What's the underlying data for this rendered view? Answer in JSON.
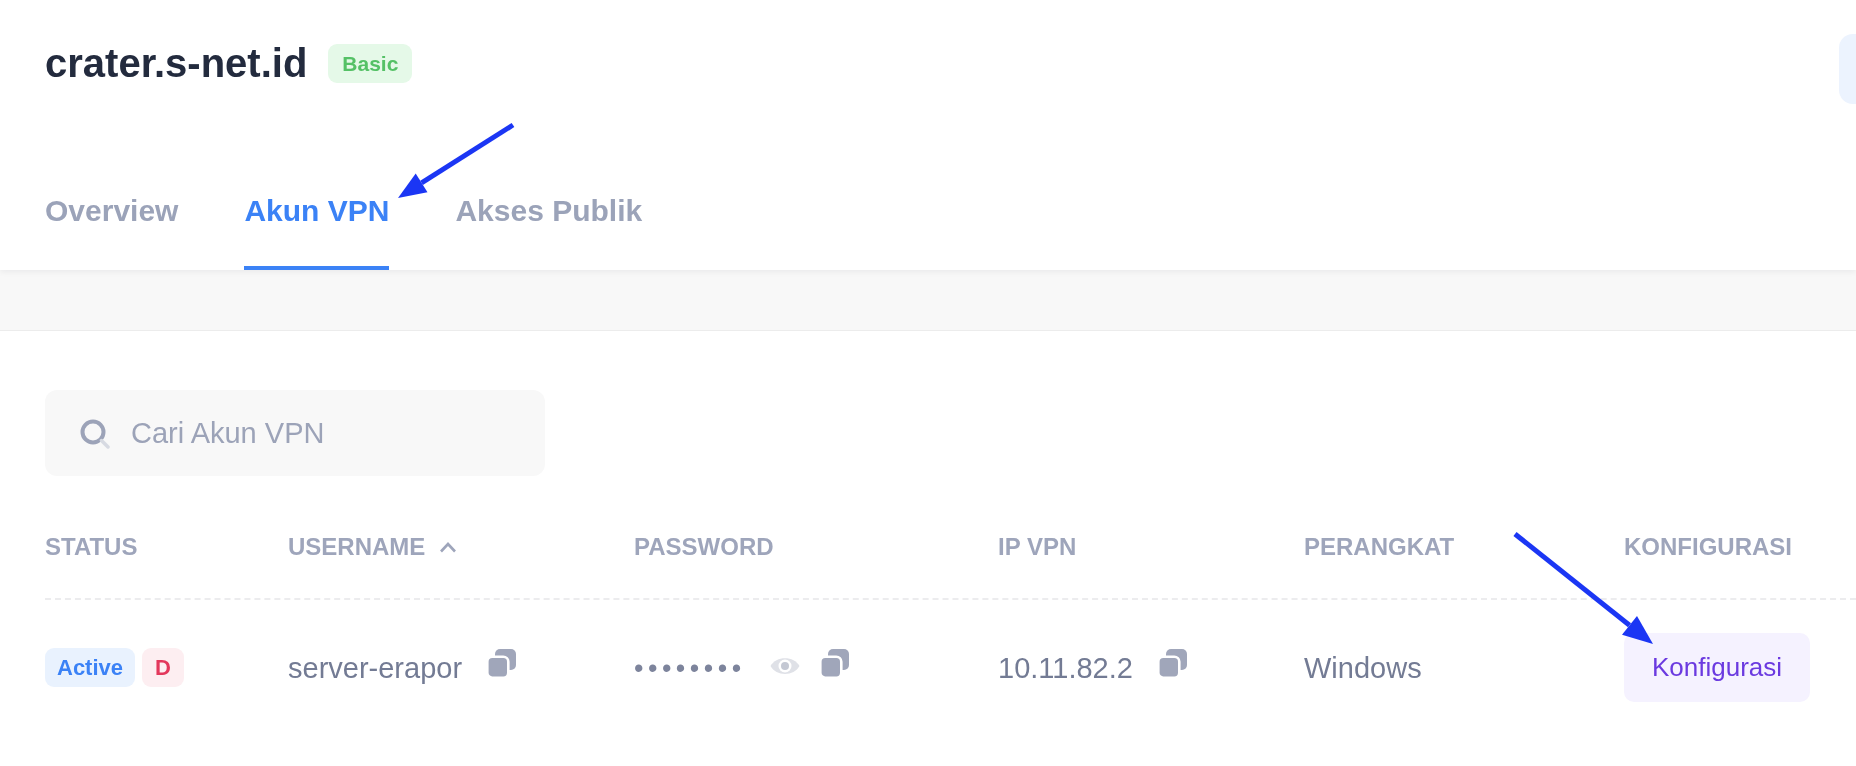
{
  "header": {
    "title": "crater.s-net.id",
    "plan_badge": "Basic"
  },
  "tabs": [
    {
      "label": "Overview",
      "selected": false
    },
    {
      "label": "Akun VPN",
      "selected": true
    },
    {
      "label": "Akses Publik",
      "selected": false
    }
  ],
  "search": {
    "placeholder": "Cari Akun VPN"
  },
  "table": {
    "columns": [
      {
        "label": "STATUS",
        "sorted": false
      },
      {
        "label": "USERNAME",
        "sorted": true
      },
      {
        "label": "PASSWORD",
        "sorted": false
      },
      {
        "label": "IP VPN",
        "sorted": false
      },
      {
        "label": "PERANGKAT",
        "sorted": false
      },
      {
        "label": "KONFIGURASI",
        "sorted": false
      }
    ],
    "rows": [
      {
        "badges": [
          {
            "text": "Active",
            "kind": "status"
          },
          {
            "text": "D",
            "kind": "flag"
          }
        ],
        "username": "server-erapor",
        "password": "••••••••",
        "ip_vpn": "10.11.82.2",
        "device": "Windows",
        "config_button": "Konfigurasi"
      }
    ]
  },
  "annotations": {
    "arrow_to_selected_tab": true,
    "arrow_to_config_button": true
  }
}
